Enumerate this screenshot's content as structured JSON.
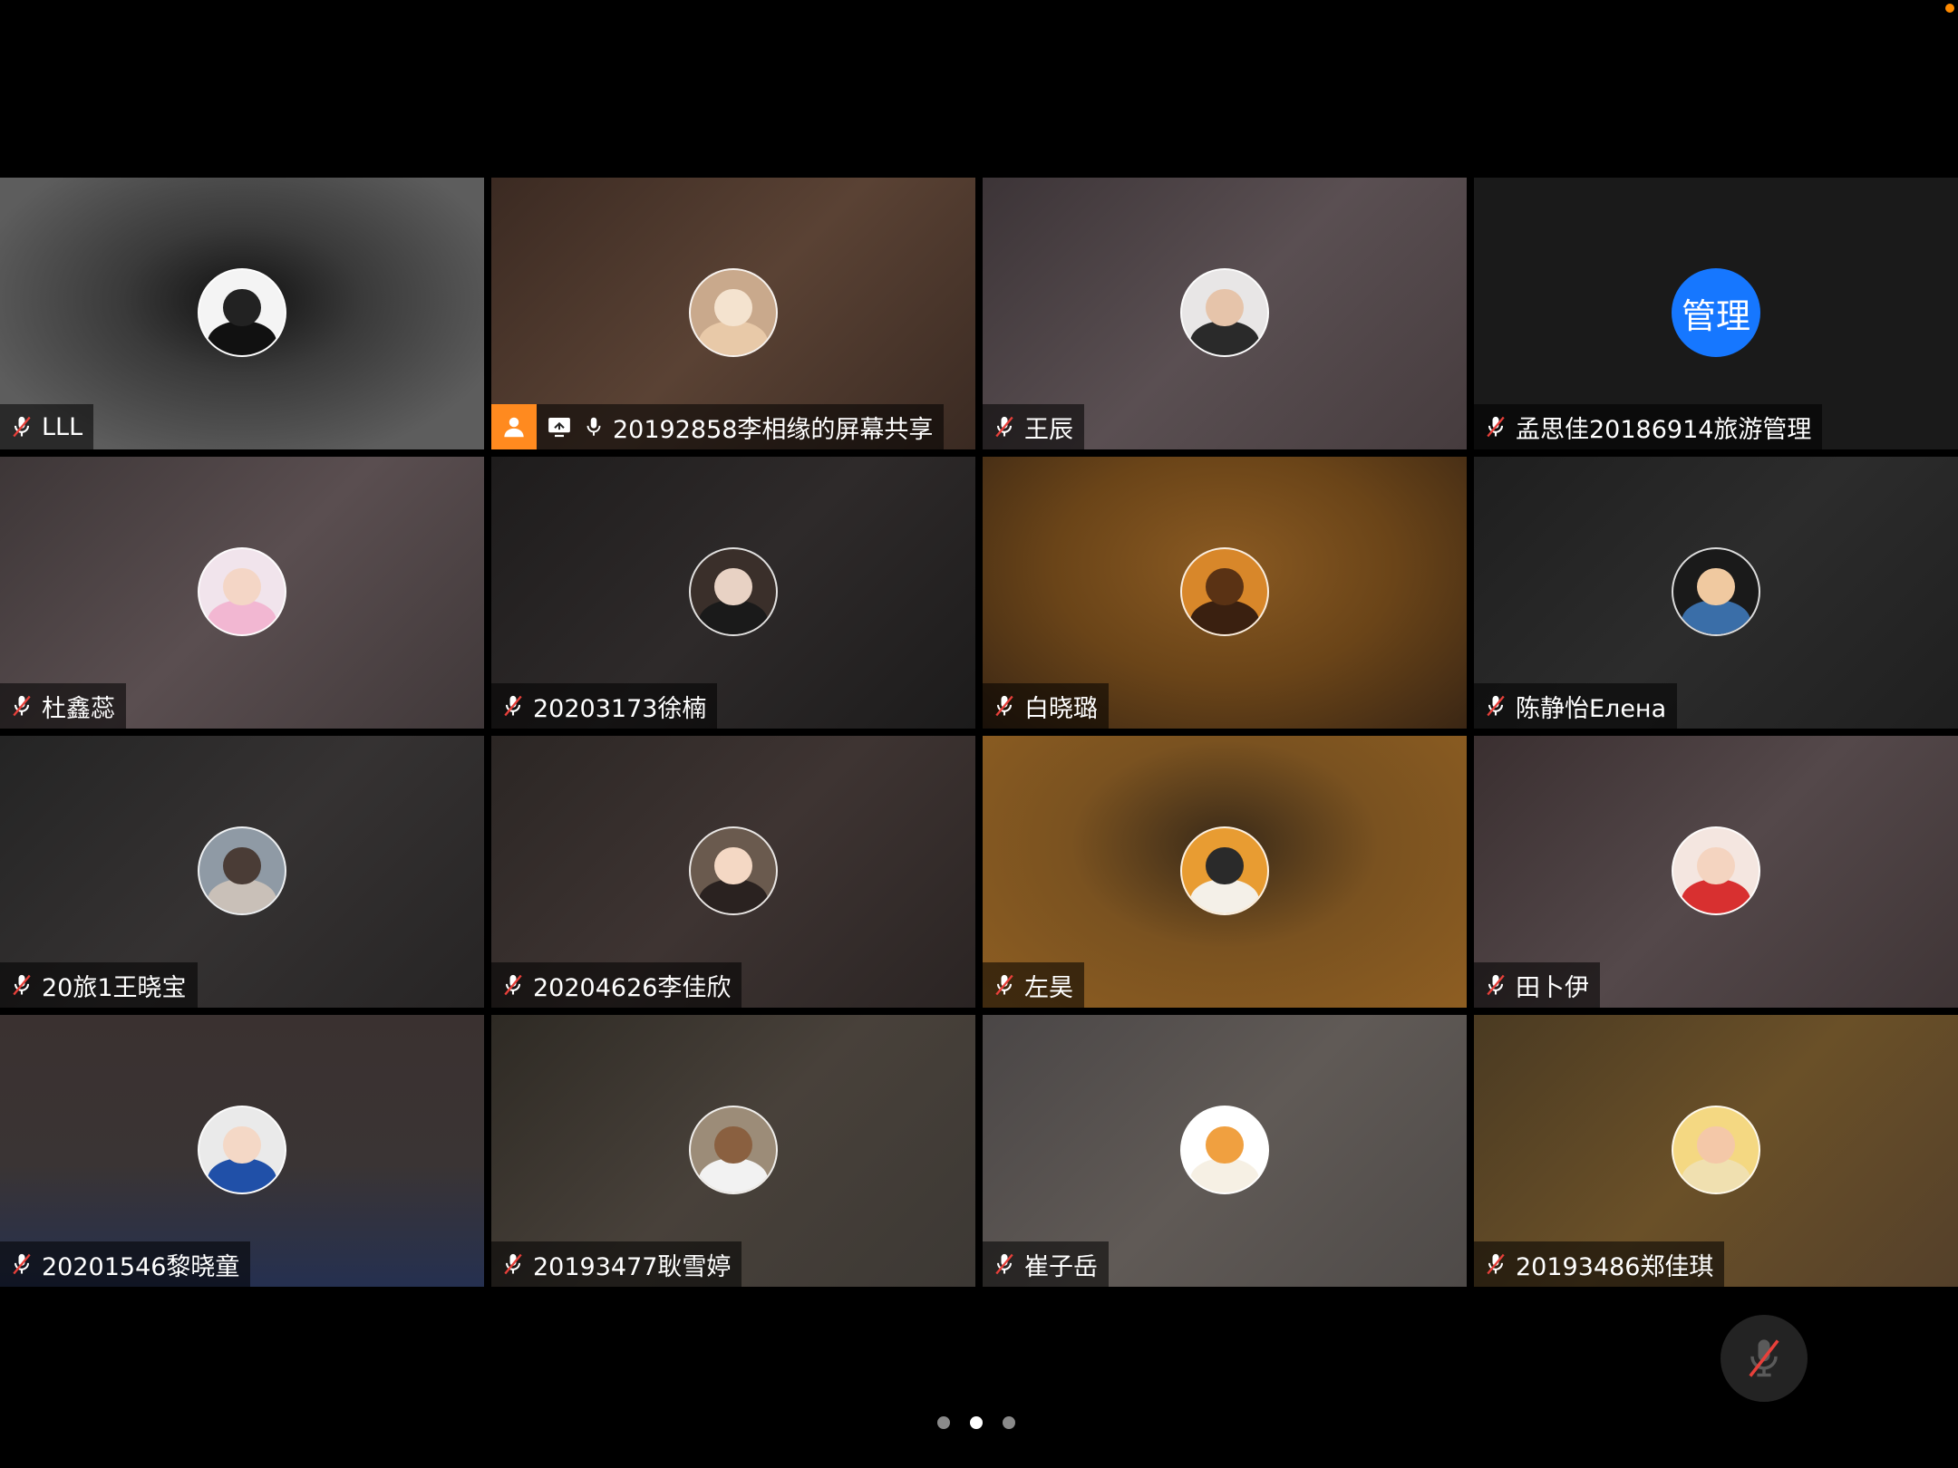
{
  "participants": [
    {
      "name": "LLL",
      "bg": "radial-gradient(ellipse at 50% 45%, #111 0%, #3a3a3a 35%, #5d5d5d 80%)",
      "avatar": {
        "type": "image",
        "bg": "#f4f4f4",
        "face": "#222",
        "body": "#111"
      },
      "muted": true
    },
    {
      "name": "20192858李相缘的屏幕共享",
      "bg": "linear-gradient(135deg, #3b2a22 0%, #5a4234 50%, #3a2a22 100%)",
      "avatar": {
        "type": "image",
        "bg": "#c9a98c",
        "face": "#f4e3cf",
        "body": "#e8c9a8"
      },
      "muted": false,
      "sharing": true
    },
    {
      "name": "王辰",
      "bg": "linear-gradient(135deg, #3c3437 0%, #5a4f52 50%, #463c3e 100%)",
      "avatar": {
        "type": "image",
        "bg": "#e8e6e6",
        "face": "#e6c4aa",
        "body": "#2a2a2a"
      },
      "muted": true
    },
    {
      "name": "孟思佳20186914旅游管理",
      "bg": "#1a1a1a",
      "avatar": {
        "type": "text",
        "label": "管理"
      },
      "muted": true
    },
    {
      "name": "杜鑫蕊",
      "bg": "linear-gradient(135deg, #3d3637 0%, #5a4e50 50%, #403839 100%)",
      "avatar": {
        "type": "image",
        "bg": "#f1e4ec",
        "face": "#f4d6c6",
        "body": "#f2b7d2"
      },
      "muted": true
    },
    {
      "name": "20203173徐楠",
      "bg": "linear-gradient(135deg, #1e1c1c 0%, #2e2a2a 50%, #1c1b1b 100%)",
      "avatar": {
        "type": "image",
        "bg": "#3a2f2a",
        "face": "#e8d2c4",
        "body": "#1a1a1a"
      },
      "muted": true
    },
    {
      "name": "白晓璐",
      "bg": "radial-gradient(ellipse at 50% 40%, #8a5a22 0%, #6a4418 50%, #3a2614 100%)",
      "avatar": {
        "type": "image",
        "bg": "#d8872a",
        "face": "#5a3214",
        "body": "#3a2010"
      },
      "muted": true
    },
    {
      "name": "陈静怡Елена",
      "bg": "linear-gradient(135deg, #1e1e1e 0%, #2c2c2c 50%, #1f1f1f 100%)",
      "avatar": {
        "type": "image",
        "bg": "#1a1a1a",
        "face": "#f0c9a0",
        "body": "#3a6ea8"
      },
      "muted": true
    },
    {
      "name": "20旅1王晓宝",
      "bg": "linear-gradient(135deg, #242424 0%, #353232 50%, #262424 100%)",
      "avatar": {
        "type": "image",
        "bg": "#8f9aa5",
        "face": "#4a3c36",
        "body": "#c9c0b8"
      },
      "muted": true
    },
    {
      "name": "20204626李佳欣",
      "bg": "linear-gradient(135deg, #2b2624 0%, #3e3432 50%, #2a2423 100%)",
      "avatar": {
        "type": "image",
        "bg": "#6a5a4e",
        "face": "#f4d8c4",
        "body": "#2a2220"
      },
      "muted": true
    },
    {
      "name": "左昊",
      "bg": "radial-gradient(ellipse at 50% 40%, #3a2a18 0%, #7a5220 45%, #8e5e22 100%)",
      "avatar": {
        "type": "image",
        "bg": "#e89c32",
        "face": "#2a2a2a",
        "body": "#f4f0e8"
      },
      "muted": true
    },
    {
      "name": "田卜伊",
      "bg": "linear-gradient(135deg, #3a2f30 0%, #54484a 50%, #3f3536 100%)",
      "avatar": {
        "type": "image",
        "bg": "#f4e6e0",
        "face": "#f4d4c0",
        "body": "#d83030"
      },
      "muted": true
    },
    {
      "name": "20201546黎晓童",
      "bg": "linear-gradient(180deg, #3a3130 0%, #3a3434 55%, #253050 100%)",
      "avatar": {
        "type": "image",
        "bg": "#eaeaea",
        "face": "#f4d8c6",
        "body": "#2050a8"
      },
      "muted": true
    },
    {
      "name": "20193477耿雪婷",
      "bg": "linear-gradient(135deg, #2e2a24 0%, #48413a 50%, #3c3834 100%)",
      "avatar": {
        "type": "image",
        "bg": "#9c8c78",
        "face": "#8a6040",
        "body": "#f2f2f2"
      },
      "muted": true
    },
    {
      "name": "崔子岳",
      "bg": "linear-gradient(135deg, #4a4646 0%, #605a56 50%, #4e4a48 100%)",
      "avatar": {
        "type": "image",
        "bg": "#ffffff",
        "face": "#f0a040",
        "body": "#f6f0e4"
      },
      "muted": true
    },
    {
      "name": "20193486郑佳琪",
      "bg": "linear-gradient(135deg, #4a3a22 0%, #6a5028 50%, #54402a 100%)",
      "avatar": {
        "type": "image",
        "bg": "#f4d882",
        "face": "#f4c8a8",
        "body": "#f0e0b0"
      },
      "muted": true
    }
  ],
  "pager": {
    "pages": 3,
    "active": 1
  },
  "colors": {
    "share_badge": "#ff8a1f",
    "admin_avatar": "#1677ff",
    "muted_red": "#e8403a"
  }
}
